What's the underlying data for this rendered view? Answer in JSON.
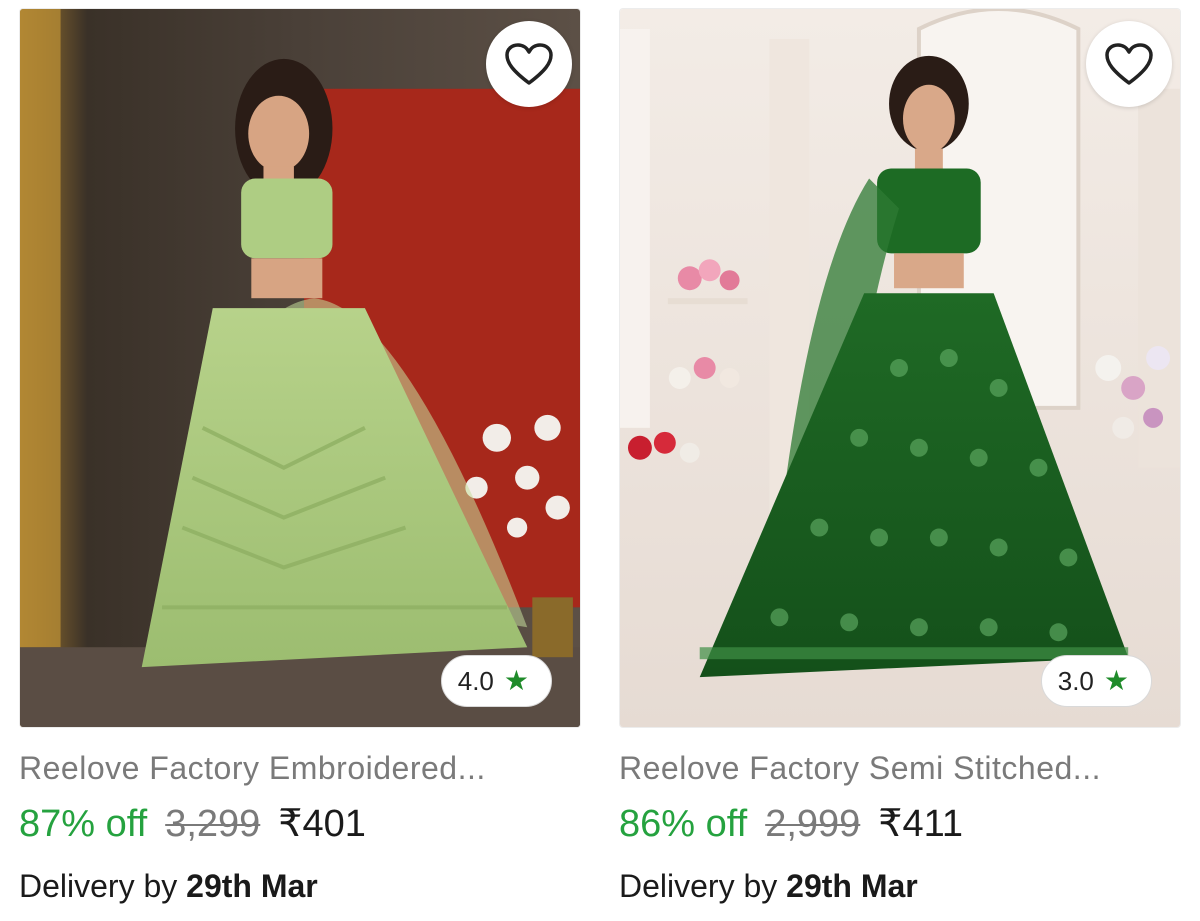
{
  "products": [
    {
      "title": "Reelove Factory Embroidered...",
      "discount": "87% off",
      "mrp": "3,299",
      "price": "₹401",
      "rating": "4.0",
      "delivery_prefix": "Delivery by",
      "delivery_date": "29th Mar",
      "wishlist_icon": "heart-outline-icon",
      "rating_icon": "star-icon",
      "colors": {
        "discount": "#25a23f",
        "star": "#1f8b2a"
      }
    },
    {
      "title": "Reelove Factory Semi Stitched...",
      "discount": "86% off",
      "mrp": "2,999",
      "price": "₹411",
      "rating": "3.0",
      "delivery_prefix": "Delivery by",
      "delivery_date": "29th Mar",
      "wishlist_icon": "heart-outline-icon",
      "rating_icon": "star-icon",
      "colors": {
        "discount": "#25a23f",
        "star": "#1f8b2a"
      }
    }
  ]
}
